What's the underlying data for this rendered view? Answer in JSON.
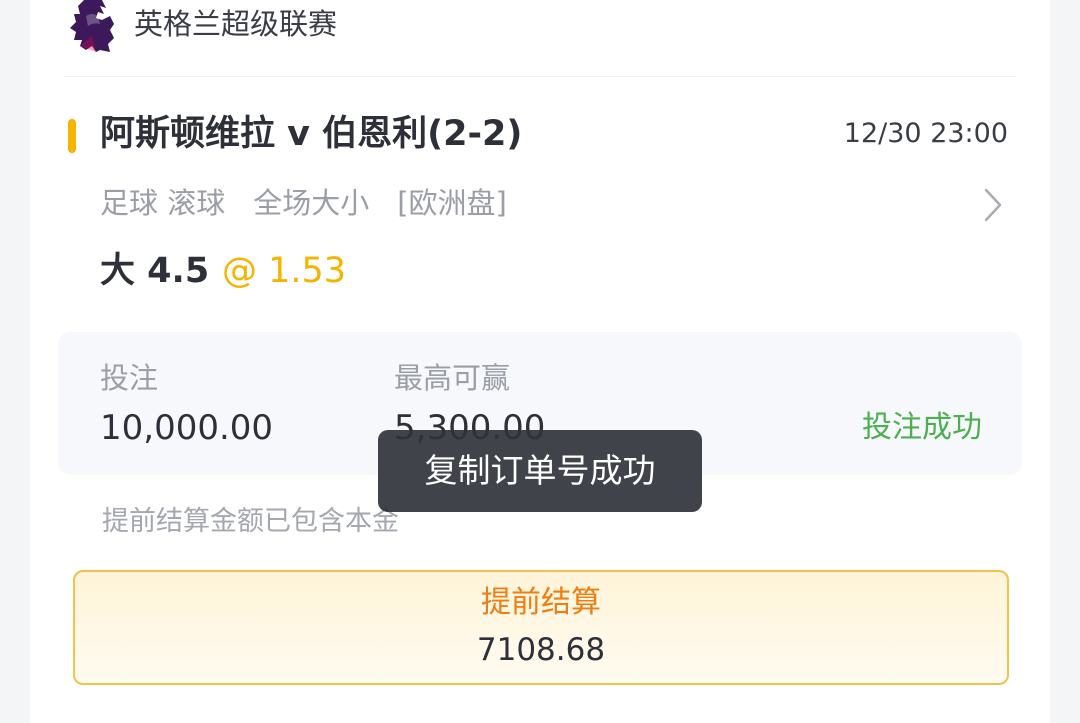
{
  "league": {
    "name": "英格兰超级联赛",
    "logo_icon": "premier-league-lion-icon",
    "logo_color": "#3d195b"
  },
  "match": {
    "title": "阿斯顿维拉 v 伯恩利(2-2)",
    "time": "12/30 23:00",
    "accent_color": "#f6b300"
  },
  "market": {
    "sport": "足球 滚球",
    "type": "全场大小",
    "odds_format": "[欧洲盘]"
  },
  "selection": {
    "pick": "大 4.5",
    "odds": "@ 1.53"
  },
  "bet": {
    "stake_label": "投注",
    "stake_value": "10,000.00",
    "max_win_label": "最高可赢",
    "max_win_value": "5,300.00",
    "status": "投注成功",
    "status_color": "#4caf50"
  },
  "cashout": {
    "note": "提前结算金额已包含本金",
    "button_label": "提前结算",
    "amount": "7108.68",
    "label_color": "#ee7d12"
  },
  "toast": {
    "message": "复制订单号成功"
  },
  "icons": {
    "chevron": "chevron-right-icon"
  }
}
